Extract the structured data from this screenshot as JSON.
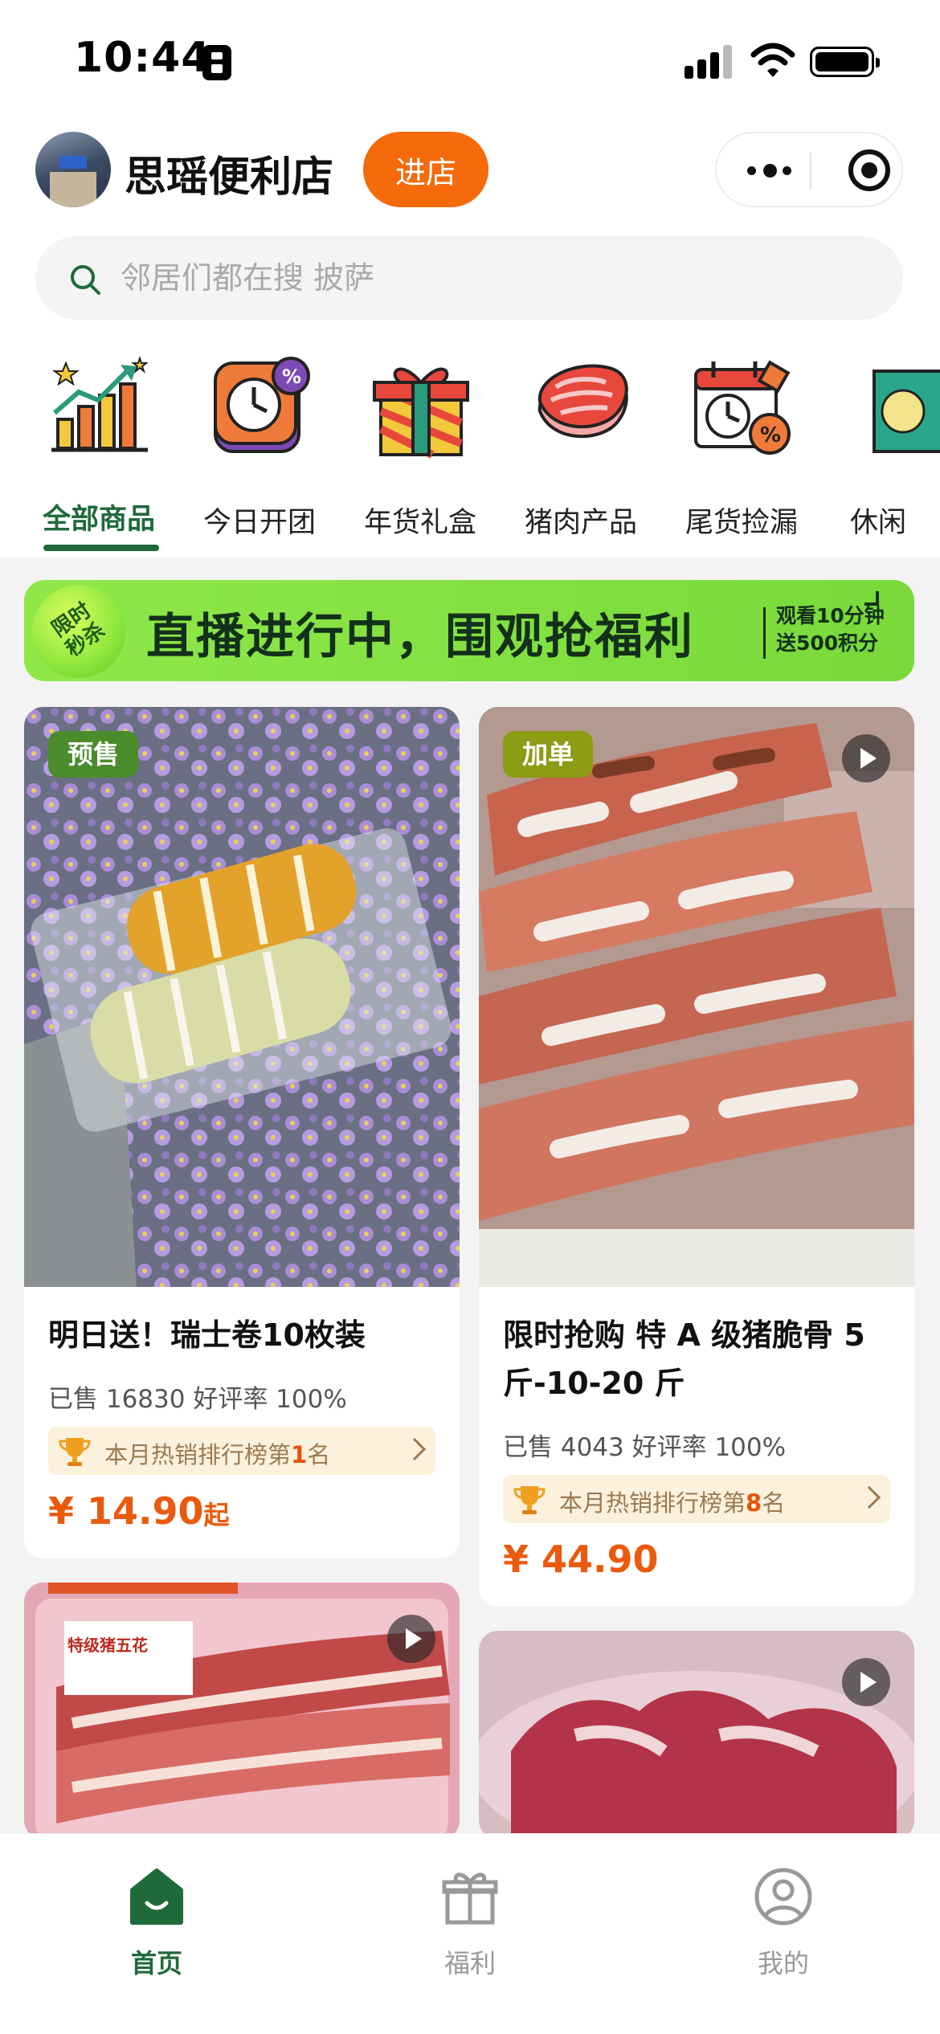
{
  "status_bar": {
    "time": "10:44"
  },
  "header": {
    "store_name": "思瑶便利店",
    "enter_button": "进店"
  },
  "search": {
    "placeholder": "邻居们都在搜 披萨"
  },
  "categories": [
    {
      "label": "全部商品",
      "icon": "chart-growth-icon",
      "active": true
    },
    {
      "label": "今日开团",
      "icon": "clock-discount-icon"
    },
    {
      "label": "年货礼盒",
      "icon": "gift-box-icon"
    },
    {
      "label": "猪肉产品",
      "icon": "pork-meat-icon"
    },
    {
      "label": "尾货捡漏",
      "icon": "calendar-discount-icon"
    },
    {
      "label": "休闲",
      "icon": "snack-icon"
    }
  ],
  "banner": {
    "badge": "限时秒杀",
    "title": "直播进行中，围观抢福利",
    "sub_line1": "观看10分钟",
    "sub_line2": "送500积分"
  },
  "products": [
    {
      "tag": "预售",
      "title": "明日送！瑞士卷10枚装",
      "meta": "已售 16830 好评率 100%",
      "rank_prefix": "本月热销排行榜第",
      "rank_num": "1",
      "rank_suffix": "名",
      "price": "¥ 14.90",
      "price_suffix": "起"
    },
    {
      "tag": "加单",
      "title": "限时抢购 特 A 级猪脆骨 5斤-10-20 斤",
      "meta": "已售 4043 好评率 100%",
      "rank_prefix": "本月热销排行榜第",
      "rank_num": "8",
      "rank_suffix": "名",
      "price": "¥ 44.90",
      "price_suffix": ""
    },
    {
      "label_card_text": "特级猪五花"
    }
  ],
  "bottom_nav": [
    {
      "label": "首页",
      "icon": "home-icon",
      "active": true
    },
    {
      "label": "福利",
      "icon": "gift-icon"
    },
    {
      "label": "我的",
      "icon": "profile-icon"
    }
  ],
  "colors": {
    "brand_green": "#1f6a3a",
    "accent_orange": "#f56a0a",
    "price_orange": "#ea5a0c",
    "banner_green": "#8fe84a"
  }
}
